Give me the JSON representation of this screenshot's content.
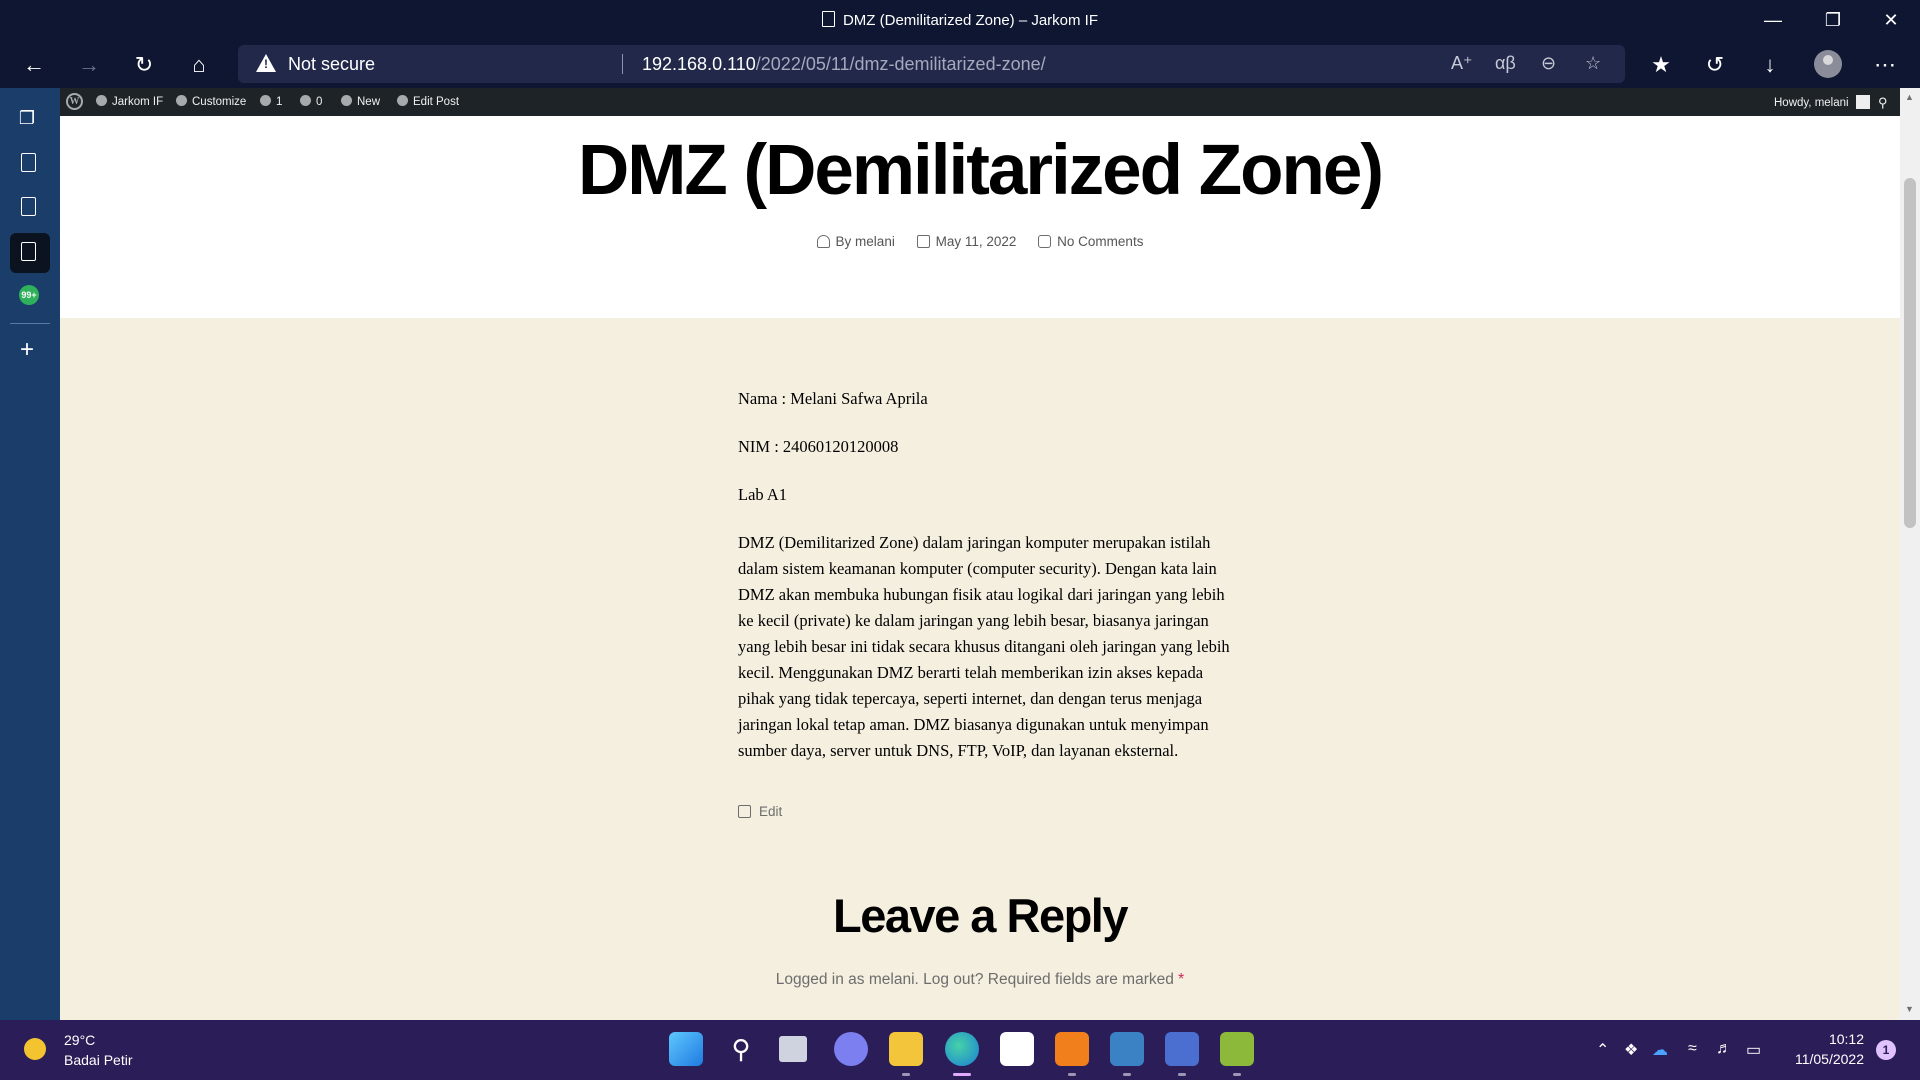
{
  "window": {
    "title": "DMZ (Demilitarized Zone) – Jarkom IF"
  },
  "address_bar": {
    "security": "Not secure",
    "host": "192.168.0.110",
    "path": "/2022/05/11/dmz-demilitarized-zone/"
  },
  "admin_bar": {
    "site_name": "Jarkom IF",
    "customize": "Customize",
    "updates": "1",
    "comments": "0",
    "new": "New",
    "edit_post": "Edit Post",
    "howdy": "Howdy, melani"
  },
  "post": {
    "title": "DMZ (Demilitarized Zone)",
    "author": "By melani",
    "date": "May 11, 2022",
    "comments": "No Comments",
    "paragraphs": [
      "Nama : Melani Safwa Aprila",
      "NIM : 24060120120008",
      "Lab A1",
      "DMZ (Demilitarized Zone) dalam jaringan komputer merupakan istilah dalam sistem keamanan komputer (computer security). Dengan kata lain DMZ akan membuka hubungan fisik atau logikal dari jaringan yang lebih ke kecil (private) ke dalam jaringan yang lebih besar, biasanya jaringan yang lebih besar ini tidak secara khusus ditangani oleh jaringan yang lebih kecil. Menggunakan DMZ berarti telah memberikan izin akses kepada pihak yang tidak tepercaya, seperti internet, dan dengan terus menjaga jaringan lokal tetap aman. DMZ biasanya digunakan untuk menyimpan sumber daya, server untuk DNS, FTP, VoIP, dan layanan eksternal."
    ],
    "edit_link": "Edit"
  },
  "reply": {
    "title": "Leave a Reply",
    "logged_in": "Logged in as melani. Log out? Required fields are marked ",
    "required_mark": "*"
  },
  "sidebar": {
    "badge": "99+"
  },
  "taskbar": {
    "temperature": "29°C",
    "weather": "Badai Petir",
    "time": "10:12",
    "date": "11/05/2022",
    "notifications": "1"
  }
}
